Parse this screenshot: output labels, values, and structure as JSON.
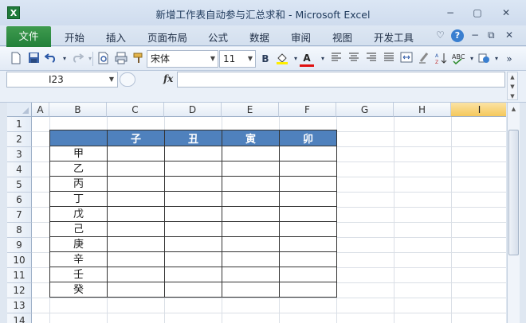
{
  "window": {
    "title": "新增工作表自动参与汇总求和  -  Microsoft Excel",
    "app_icon": "X",
    "minimize": "−",
    "restore": "▢",
    "close": "✕"
  },
  "ribbon": {
    "file_tab": "文件",
    "tabs": [
      "开始",
      "插入",
      "页面布局",
      "公式",
      "数据",
      "审阅",
      "视图",
      "开发工具"
    ],
    "right_icons": {
      "collapse": "♡",
      "help": "?",
      "min": "−",
      "restore": "⧉",
      "close": "✕"
    }
  },
  "toolbar": {
    "font_name": "宋体",
    "font_size": "11",
    "bold": "B",
    "font_color_letter": "A",
    "overflow": "»"
  },
  "formula_bar": {
    "name_box": "I23",
    "fx": "fx",
    "formula": ""
  },
  "grid": {
    "columns": [
      "A",
      "B",
      "C",
      "D",
      "E",
      "F",
      "G",
      "H",
      "I"
    ],
    "selected_column": "I",
    "rows": [
      "1",
      "2",
      "3",
      "4",
      "5",
      "6",
      "7",
      "8",
      "9",
      "10",
      "11",
      "12",
      "13",
      "14"
    ],
    "table": {
      "headers": [
        "",
        "子",
        "丑",
        "寅",
        "卯"
      ],
      "row_labels": [
        "甲",
        "乙",
        "丙",
        "丁",
        "戊",
        "己",
        "庚",
        "辛",
        "壬",
        "癸"
      ]
    }
  },
  "colors": {
    "file_tab": "#22813a",
    "table_header": "#4f81bd",
    "selected_header": "#f5c85c"
  }
}
